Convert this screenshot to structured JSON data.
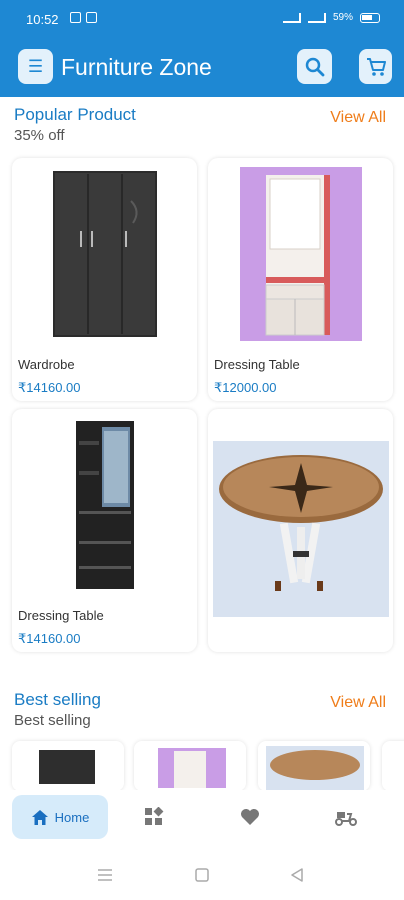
{
  "status_bar": {
    "time": "10:52",
    "battery": "59%"
  },
  "app_bar": {
    "title": "Furniture Zone"
  },
  "popular": {
    "title": "Popular Product",
    "subtitle": "35% off",
    "view_all": "View All",
    "products": [
      {
        "name": "Wardrobe",
        "price": "₹14160.00"
      },
      {
        "name": "Dressing Table",
        "price": "₹12000.00"
      },
      {
        "name": "Dressing Table",
        "price": "₹14160.00"
      },
      {
        "name": "",
        "price": ""
      }
    ]
  },
  "best_selling": {
    "title": "Best selling",
    "subtitle": "Best selling",
    "view_all": "View All"
  },
  "bottom_nav": {
    "home_label": "Home"
  },
  "colors": {
    "primary": "#1e88d3",
    "accent": "#ef7d1a",
    "price": "#1a7cc4"
  }
}
